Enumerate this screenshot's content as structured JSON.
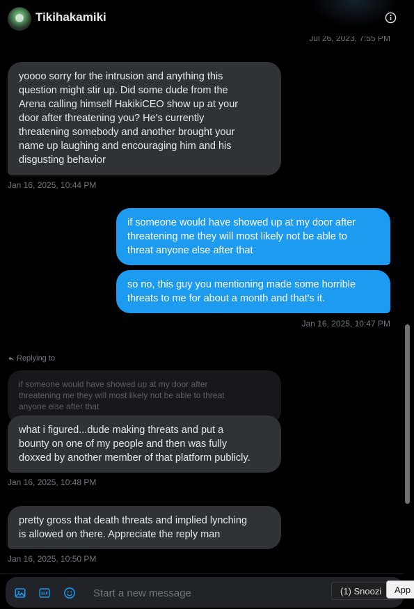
{
  "header": {
    "user_name": "Tikihakamiki",
    "top_timestamp": "Jul 26, 2023, 7:55 PM"
  },
  "messages": [
    {
      "direction": "received",
      "lines": [
        "yoooo sorry for the intrusion and anything this",
        "question might stir up. Did some dude from the",
        "Arena calling himself HakikiCEO show up at your",
        "door after threatening you? He's currently",
        "threatening somebody and another brought your",
        "name up laughing and encouraging him and his",
        "disgusting behavior"
      ],
      "timestamp": "Jan 16, 2025, 10:44 PM"
    },
    {
      "direction": "sent",
      "lines": [
        "if someone would have showed up at my door after",
        "threatening me they will most likely not be able to",
        "threat anyone else after that"
      ]
    },
    {
      "direction": "sent",
      "lines": [
        "so no, this guy you mentioning made some horrible",
        "threats to me for about a month and that's it."
      ],
      "timestamp": "Jan 16, 2025, 10:47 PM"
    },
    {
      "direction": "received",
      "replying_label": "Replying to",
      "quoted_lines": [
        "if someone would have showed up at my door after",
        "threatening me they will most likely not be able to threat",
        "anyone else after that"
      ],
      "lines": [
        "what i figured...dude making threats and put a",
        "bounty on one of my people and then was fully",
        "doxxed by another member of that platform publicly."
      ],
      "timestamp": "Jan 16, 2025, 10:48 PM"
    },
    {
      "direction": "received",
      "lines": [
        "pretty gross that death threats and implied lynching",
        "is allowed on there. Appreciate the reply man"
      ],
      "timestamp": "Jan 16, 2025, 10:50 PM"
    }
  ],
  "composer": {
    "placeholder": "Start a new message",
    "icons": [
      "image-icon",
      "gif-icon",
      "emoji-icon"
    ]
  },
  "taskbar": {
    "snooze_label": "(1) Snoozi",
    "app_label": "App"
  },
  "colors": {
    "sent_bubble": "#1d9bf0",
    "received_bubble": "#2f3336",
    "accent": "#1d9bf0",
    "background": "#000000"
  }
}
